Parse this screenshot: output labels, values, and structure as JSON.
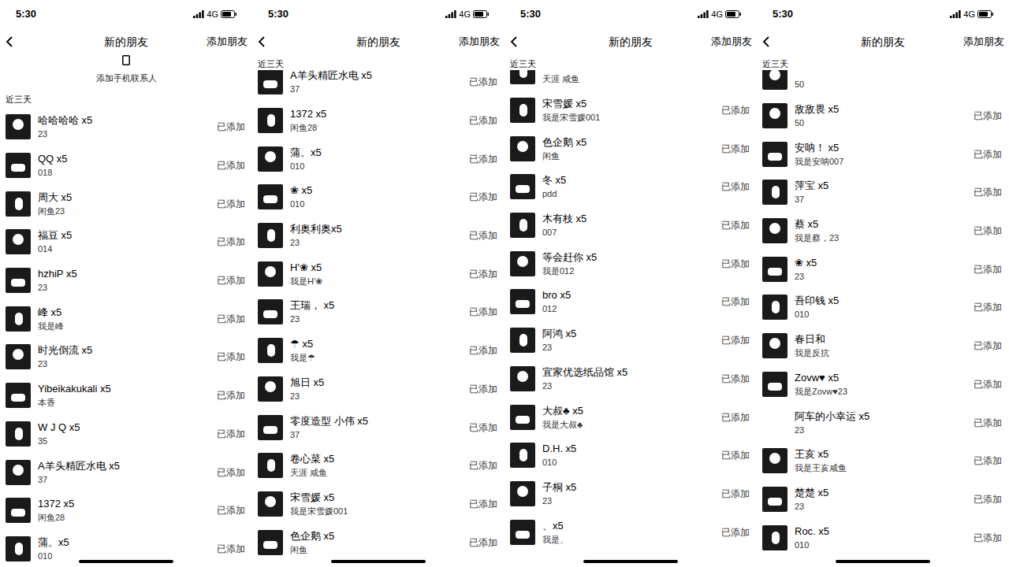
{
  "panels": [
    {
      "status_bar": {
        "time": "5:30",
        "network": "4G"
      },
      "nav": {
        "title": "新的朋友",
        "action": "添加朋友"
      },
      "add_contacts": "添加手机联系人",
      "section": "近三天",
      "friends": [
        {
          "name": "哈哈哈哈 x5",
          "sub": "23",
          "status": "已添加",
          "avatar": true
        },
        {
          "name": "QQ x5",
          "sub": "018",
          "status": "已添加",
          "avatar": true
        },
        {
          "name": "周大 x5",
          "sub": "闲鱼23",
          "status": "已添加",
          "avatar": true
        },
        {
          "name": "福豆 x5",
          "sub": "014",
          "status": "已添加",
          "avatar": true
        },
        {
          "name": "hzhiP x5",
          "sub": "23",
          "status": "已添加",
          "avatar": true
        },
        {
          "name": "峰 x5",
          "sub": "我是峰",
          "status": "已添加",
          "avatar": true
        },
        {
          "name": "时光倒流 x5",
          "sub": "23",
          "status": "已添加",
          "avatar": true
        },
        {
          "name": "Yibeikakukali x5",
          "sub": "本香",
          "status": "已添加",
          "avatar": true
        },
        {
          "name": "W J Q x5",
          "sub": "35",
          "status": "已添加",
          "avatar": true
        },
        {
          "name": "A羊头精匠水电 x5",
          "sub": "37",
          "status": "已添加",
          "avatar": true
        },
        {
          "name": "1372 x5",
          "sub": "闲鱼28",
          "status": "已添加",
          "avatar": true
        },
        {
          "name": "蒲。x5",
          "sub": "010",
          "status": "已添加",
          "avatar": true
        }
      ]
    },
    {
      "status_bar": {
        "time": "5:30",
        "network": "4G"
      },
      "nav": {
        "title": "新的朋友",
        "action": "添加朋友"
      },
      "section": "近三天",
      "friends": [
        {
          "name": "A羊头精匠水电 x5",
          "sub": "37",
          "status": "已添加",
          "avatar": true
        },
        {
          "name": "1372 x5",
          "sub": "闲鱼28",
          "status": "已添加",
          "avatar": true
        },
        {
          "name": "蒲。x5",
          "sub": "010",
          "status": "已添加",
          "avatar": true
        },
        {
          "name": "❀ x5",
          "sub": "010",
          "status": "已添加",
          "avatar": true
        },
        {
          "name": "利奥利奥x5",
          "sub": "23",
          "status": "已添加",
          "avatar": true
        },
        {
          "name": "H'❀ x5",
          "sub": "我是H'❀",
          "status": "已添加",
          "avatar": true
        },
        {
          "name": "王瑞， x5",
          "sub": "23",
          "status": "已添加",
          "avatar": true
        },
        {
          "name": "☂ x5",
          "sub": "我是☂",
          "status": "已添加",
          "avatar": true
        },
        {
          "name": "旭日 x5",
          "sub": "23",
          "status": "已添加",
          "avatar": true
        },
        {
          "name": "零度造型  小伟 x5",
          "sub": "37",
          "status": "已添加",
          "avatar": true
        },
        {
          "name": "卷心菜 x5",
          "sub": "天涯 咸鱼",
          "status": "已添加",
          "avatar": true
        },
        {
          "name": "宋雪媛 x5",
          "sub": "我是宋雪媛001",
          "status": "已添加",
          "avatar": true
        },
        {
          "name": "色企鹅 x5",
          "sub": "闲鱼",
          "status": "已添加",
          "avatar": true
        }
      ]
    },
    {
      "status_bar": {
        "time": "5:30",
        "network": "4G"
      },
      "nav": {
        "title": "新的朋友",
        "action": "添加朋友"
      },
      "section": "近三天",
      "partial_top": {
        "sub": "天涯 咸鱼"
      },
      "friends": [
        {
          "name": "宋雪媛 x5",
          "sub": "我是宋雪媛001",
          "status": "已添加",
          "avatar": true
        },
        {
          "name": "色企鹅 x5",
          "sub": "闲鱼",
          "status": "已添加",
          "avatar": true
        },
        {
          "name": "冬 x5",
          "sub": "pdd",
          "status": "已添加",
          "avatar": true
        },
        {
          "name": "木有枝 x5",
          "sub": "007",
          "status": "已添加",
          "avatar": true
        },
        {
          "name": "等会赶你 x5",
          "sub": "我是012",
          "status": "已添加",
          "avatar": true
        },
        {
          "name": "bro x5",
          "sub": "012",
          "status": "已添加",
          "avatar": true
        },
        {
          "name": "阿鸿 x5",
          "sub": "23",
          "status": "已添加",
          "avatar": true
        },
        {
          "name": "宜家优选纸品馆 x5",
          "sub": "23",
          "status": "已添加",
          "avatar": true
        },
        {
          "name": "大叔♣ x5",
          "sub": "我是大叔♣",
          "status": "已添加",
          "avatar": true
        },
        {
          "name": "D.H. x5",
          "sub": "010",
          "status": "已添加",
          "avatar": true
        },
        {
          "name": "子桐 x5",
          "sub": "23",
          "status": "已添加",
          "avatar": true
        },
        {
          "name": "、x5",
          "sub": "我是、",
          "status": "已添加",
          "avatar": true
        }
      ]
    },
    {
      "status_bar": {
        "time": "5:30",
        "network": "4G"
      },
      "nav": {
        "title": "新的朋友",
        "action": "添加朋友"
      },
      "section": "近三天",
      "partial_top": {
        "sub": "50"
      },
      "friends": [
        {
          "name": "敌敌畏 x5",
          "sub": "50",
          "status": "已添加",
          "avatar": true
        },
        {
          "name": "安呐！ x5",
          "sub": "我是安呐007",
          "status": "已添加",
          "avatar": true
        },
        {
          "name": "萍宝 x5",
          "sub": "37",
          "status": "已添加",
          "avatar": true
        },
        {
          "name": "蔡 x5",
          "sub": "我是蔡，23",
          "status": "已添加",
          "avatar": true
        },
        {
          "name": "❀ x5",
          "sub": "23",
          "status": "已添加",
          "avatar": true
        },
        {
          "name": "吾印钱 x5",
          "sub": "010",
          "status": "已添加",
          "avatar": true
        },
        {
          "name": "春日和",
          "sub": "我是反抗",
          "status": "已添加",
          "avatar": true
        },
        {
          "name": "Zovw♥ x5",
          "sub": "我是Zovw♥23",
          "status": "已添加",
          "avatar": true
        },
        {
          "name": "阿车的小幸运 x5",
          "sub": "23",
          "status": "已添加",
          "avatar": false
        },
        {
          "name": "王亥 x5",
          "sub": "我是王亥咸鱼",
          "status": "已添加",
          "avatar": true
        },
        {
          "name": "楚楚 x5",
          "sub": "23",
          "status": "已添加",
          "avatar": true
        },
        {
          "name": "Roc. x5",
          "sub": "010",
          "status": "已添加",
          "avatar": true
        }
      ]
    }
  ]
}
